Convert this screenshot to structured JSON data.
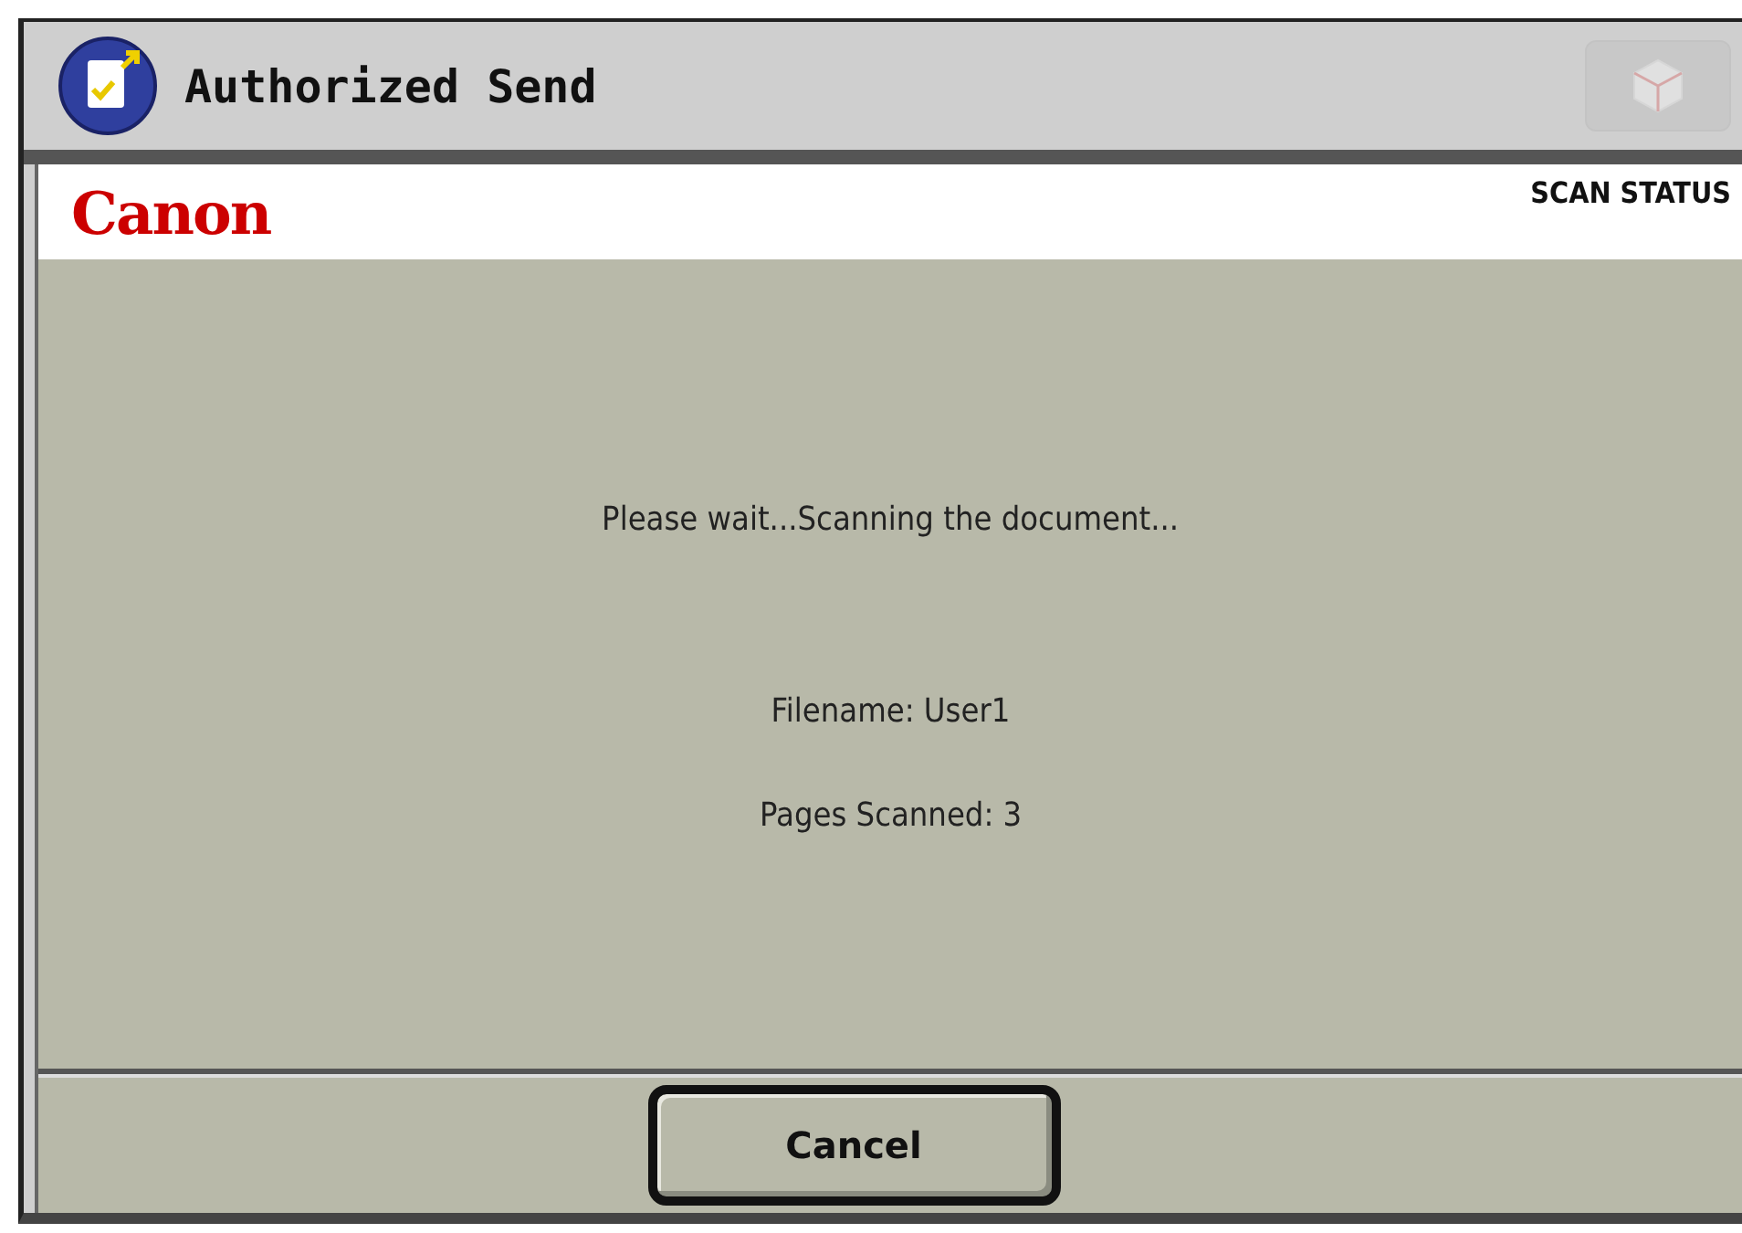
{
  "header": {
    "title": "Authorized Send",
    "home_button": {
      "disabled": true
    }
  },
  "banner": {
    "brand": "Canon",
    "status": "SCAN STATUS"
  },
  "messages": [
    {
      "text": "Please wait...Scanning the document..."
    },
    {
      "text": "Filename: User1"
    },
    {
      "text": "Pages Scanned: 3"
    }
  ],
  "footer": {
    "button": "Cancel"
  }
}
